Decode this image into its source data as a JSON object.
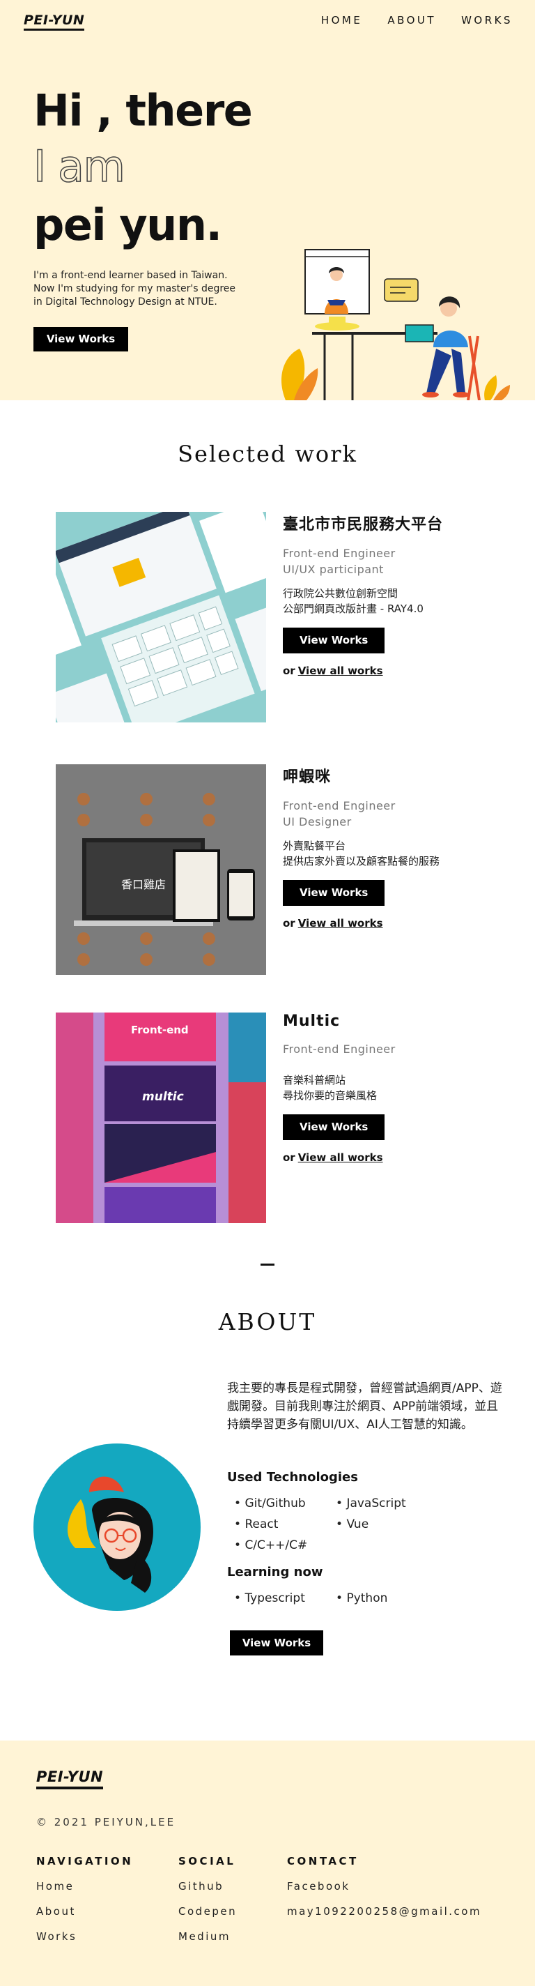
{
  "header": {
    "logo": "PEI-YUN",
    "nav": [
      "HOME",
      "ABOUT",
      "WORKS"
    ]
  },
  "hero": {
    "line1": "Hi , there",
    "line2": "I am",
    "line3": "pei yun.",
    "desc1": "I'm a front-end learner based in Taiwan.",
    "desc2": "Now I'm studying for my master's degree",
    "desc3": "in Digital Technology Design at NTUE.",
    "button": "View Works"
  },
  "works": {
    "title": "Selected work",
    "items": [
      {
        "title": "臺北市市民服務大平台",
        "role": "Front-end Engineer\nUI/UX participant",
        "desc": "行政院公共數位創新空間\n公部門網頁改版計畫 - RAY4.0",
        "button": "View Works",
        "or": "or",
        "all": "View all works"
      },
      {
        "title": "呷蝦咪",
        "role": "Front-end Engineer\nUI Designer",
        "desc": "外賣點餐平台\n提供店家外賣以及顧客點餐的服務",
        "button": "View Works",
        "or": "or",
        "all": "View all works",
        "thumb_text": "香口雞店"
      },
      {
        "title": "Multic",
        "role": "Front-end Engineer",
        "desc": "音樂科普網站\n尋找你要的音樂風格",
        "button": "View Works",
        "or": "or",
        "all": "View all works",
        "thumb_text": "Front-end",
        "thumb_brand": "multic"
      }
    ]
  },
  "about": {
    "title": "ABOUT",
    "text": "我主要的專長是程式開發，曾經嘗試過網頁/APP、遊戲開發。目前我則專注於網頁、APP前端領域，並且持續學習更多有關UI/UX、AI人工智慧的知識。",
    "used_heading": "Used Technologies",
    "used": [
      "Git/Github",
      "JavaScript",
      "React",
      "Vue",
      "C/C++/C#"
    ],
    "learning_heading": "Learning now",
    "learning": [
      "Typescript",
      "Python"
    ],
    "button": "View Works"
  },
  "footer": {
    "logo": "PEI-YUN",
    "copyright": "© 2021 PEIYUN,LEE",
    "navigation_heading": "NAVIGATION",
    "navigation": [
      "Home",
      "About",
      "Works"
    ],
    "social_heading": "SOCIAL",
    "social": [
      "Github",
      "Codepen",
      "Medium"
    ],
    "contact_heading": "CONTACT",
    "contact": [
      "Facebook",
      "may1092200258@gmail.com"
    ]
  },
  "colors": {
    "cream": "#fff4d6",
    "teal": "#14a8c0",
    "black": "#000000"
  }
}
